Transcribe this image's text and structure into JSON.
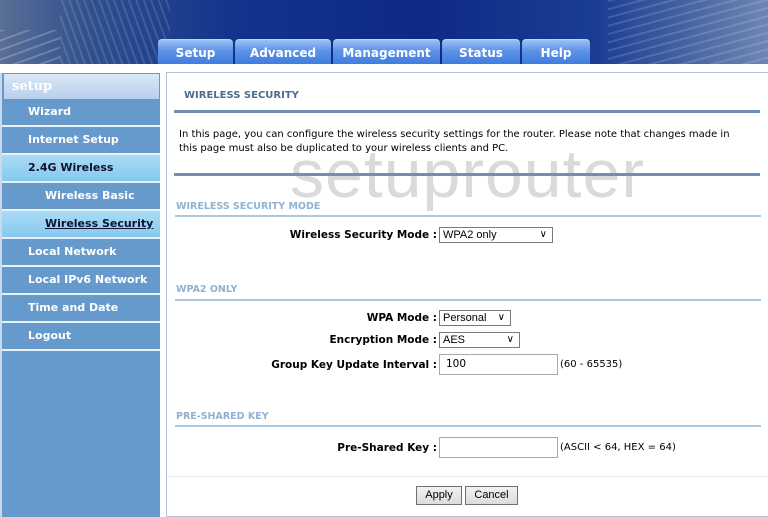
{
  "header": {
    "tabs": [
      {
        "label": "Setup"
      },
      {
        "label": "Advanced"
      },
      {
        "label": "Management"
      },
      {
        "label": "Status"
      },
      {
        "label": "Help"
      }
    ]
  },
  "sidebar": {
    "heading": "setup",
    "items": [
      {
        "label": "Wizard"
      },
      {
        "label": "Internet Setup"
      },
      {
        "label": "2.4G Wireless"
      },
      {
        "label": "Wireless Basic"
      },
      {
        "label": "Wireless Security"
      },
      {
        "label": "Local Network"
      },
      {
        "label": "Local IPv6 Network"
      },
      {
        "label": "Time and Date"
      },
      {
        "label": "Logout"
      }
    ]
  },
  "main": {
    "title": "WIRELESS SECURITY",
    "description": "In this page, you can configure the wireless security settings for the router. Please note that changes made in this page must also be duplicated to your wireless clients and PC.",
    "watermark": "setuprouter",
    "security_mode_section": {
      "title": "WIRELESS SECURITY MODE",
      "label": "Wireless Security Mode :",
      "value": "WPA2 only"
    },
    "wpa2_section": {
      "title": "WPA2 ONLY",
      "wpa_mode_label": "WPA Mode :",
      "wpa_mode_value": "Personal",
      "encryption_label": "Encryption Mode :",
      "encryption_value": "AES",
      "group_key_label": "Group Key Update Interval :",
      "group_key_value": "100",
      "group_key_hint": "(60 - 65535)"
    },
    "psk_section": {
      "title": "PRE-SHARED KEY",
      "label": "Pre-Shared Key :",
      "value": "",
      "hint": "(ASCII < 64, HEX = 64)"
    },
    "buttons": {
      "apply": "Apply",
      "cancel": "Cancel"
    }
  }
}
